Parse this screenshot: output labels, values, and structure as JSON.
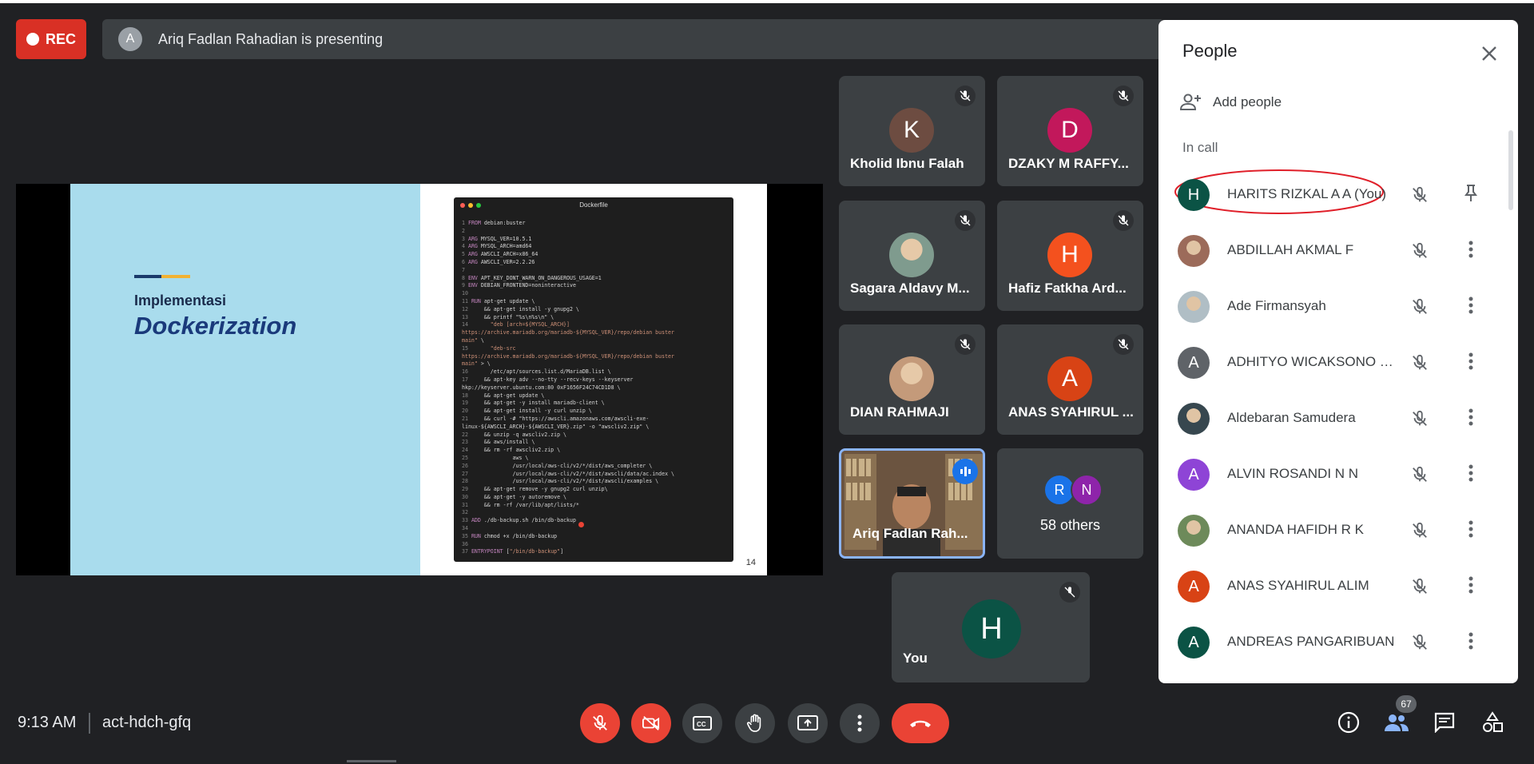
{
  "recording": {
    "label": "REC"
  },
  "presenting": {
    "avatar": "A",
    "text": "Ariq Fadlan Rahadian is presenting"
  },
  "slide": {
    "subtitle": "Implementasi",
    "title": "Dockerization",
    "code_window_title": "Dockerfile",
    "page_number": "14"
  },
  "tiles": [
    {
      "initial": "K",
      "name": "Kholid Ibnu Falah",
      "color": "#6d4c41",
      "muted": true
    },
    {
      "initial": "D",
      "name": "DZAKY M RAFFY...",
      "color": "#c2185b",
      "muted": true
    },
    {
      "initial": "",
      "name": "Sagara Aldavy M...",
      "color": "#7f9b8e",
      "muted": true,
      "photo": true
    },
    {
      "initial": "H",
      "name": "Hafiz Fatkha Ard...",
      "color": "#f4511e",
      "muted": true
    },
    {
      "initial": "",
      "name": "DIAN RAHMAJI",
      "color": "#c49a7a",
      "muted": true,
      "photo": true
    },
    {
      "initial": "A",
      "name": "ANAS SYAHIRUL ...",
      "color": "#d84315",
      "muted": true
    }
  ],
  "speaker_tile": {
    "name": "Ariq Fadlan Rah..."
  },
  "others_tile": {
    "avatar1": "R",
    "avatar2": "N",
    "label": "58 others",
    "color1": "#1a73e8",
    "color2": "#8e24aa"
  },
  "you_tile": {
    "initial": "H",
    "label": "You"
  },
  "bottom": {
    "time": "9:13 AM",
    "meeting_code": "act-hdch-gfq",
    "participant_count": "67"
  },
  "panel": {
    "title": "People",
    "add_people": "Add people",
    "in_call": "In call",
    "people": [
      {
        "initial": "H",
        "name": "HARITS RIZKAL A A (You)",
        "color": "#0b5345",
        "action": "pin-icon"
      },
      {
        "initial": "",
        "name": "ABDILLAH AKMAL F",
        "color": "#9c6b5a",
        "action": "more-icon"
      },
      {
        "initial": "",
        "name": "Ade Firmansyah",
        "color": "#b0bec5",
        "action": "more-icon"
      },
      {
        "initial": "A",
        "name": "ADHITYO WICAKSONO P...",
        "color": "#5f6368",
        "action": "more-icon"
      },
      {
        "initial": "",
        "name": "Aldebaran Samudera",
        "color": "#37474f",
        "action": "more-icon"
      },
      {
        "initial": "A",
        "name": "ALVIN ROSANDI N N",
        "color": "#8e44d6",
        "action": "more-icon"
      },
      {
        "initial": "",
        "name": "ANANDA HAFIDH R K",
        "color": "#6d8a5a",
        "action": "more-icon"
      },
      {
        "initial": "A",
        "name": "ANAS SYAHIRUL ALIM",
        "color": "#d84315",
        "action": "more-icon"
      },
      {
        "initial": "A",
        "name": "ANDREAS PANGARIBUAN",
        "color": "#0b5345",
        "action": "more-icon"
      }
    ]
  }
}
